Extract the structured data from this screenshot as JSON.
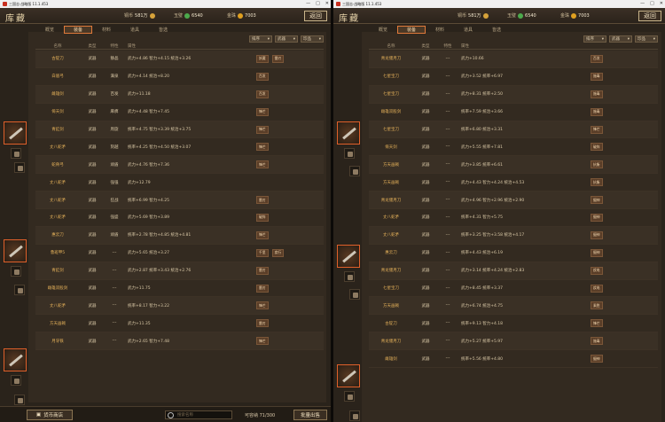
{
  "left": {
    "window_title": "三国志·战略版 11.1.453",
    "header_title": "库藏",
    "resources": [
      {
        "label": "铜币",
        "value": "581万",
        "color": "#d6a23a"
      },
      {
        "label": "玉璧",
        "value": "6540",
        "color": "#4caa4c"
      },
      {
        "label": "金珠",
        "value": "7003",
        "color": "#e0a020"
      }
    ],
    "back_label": "返回",
    "tabs": [
      "概览",
      "装备",
      "材料",
      "道具",
      "皆选"
    ],
    "active_tab": 1,
    "filters": [
      "排序",
      "武器",
      "珍品"
    ],
    "columns": [
      "名称",
      "类型",
      "特性",
      "属性"
    ],
    "rows": [
      {
        "name": "古锭刀",
        "type": "武器",
        "trait": "静晶",
        "stat": "武力+4.86 智力+4.15 统治+3.26",
        "tags": [
          "妖魔",
          "雷刃"
        ]
      },
      {
        "name": "白眉弓",
        "type": "武器",
        "trait": "满泉",
        "stat": "武力+4.14 统治+8.20",
        "tags": [
          "百发"
        ]
      },
      {
        "name": "雌雄剑",
        "type": "武器",
        "trait": "百发",
        "stat": "武力+11.18",
        "tags": [
          "百发"
        ]
      },
      {
        "name": "倚天剑",
        "type": "武器",
        "trait": "麻痹",
        "stat": "武力+4.48 智力+7.45",
        "tags": [
          "锋芒"
        ]
      },
      {
        "name": "青釭剑",
        "type": "武器",
        "trait": "周旋",
        "stat": "统率+4.75 智力+3.39 统治+3.75",
        "tags": [
          "锋芒"
        ]
      },
      {
        "name": "丈八蛇矛",
        "type": "武器",
        "trait": "刻越",
        "stat": "统率+4.25 智力+4.50 统治+3.07",
        "tags": [
          "锋芒"
        ]
      },
      {
        "name": "蛇骨弓",
        "type": "武器",
        "trait": "顽盾",
        "stat": "武力+4.76 智力+7.36",
        "tags": [
          "锋芒"
        ]
      },
      {
        "name": "丈八蛇矛",
        "type": "武器",
        "trait": "强强",
        "stat": "武力+12.79",
        "tags": []
      },
      {
        "name": "丈八蛇矛",
        "type": "武器",
        "trait": "狂战",
        "stat": "统率+6.99 智力+4.25",
        "tags": [
          "雷刃"
        ]
      },
      {
        "name": "丈八蛇矛",
        "type": "武器",
        "trait": "强盛",
        "stat": "武力+5.69 智力+3.89",
        "tags": [
          "破阵"
        ]
      },
      {
        "name": "惠云刀",
        "type": "武器",
        "trait": "顽盾",
        "stat": "统率+2.78 智力+4.85 统治+4.81",
        "tags": [
          "锋芒"
        ]
      },
      {
        "name": "鲁班甲5",
        "type": "武器",
        "trait": "---",
        "stat": "武力+5.65 统治+3.27",
        "tags": [
          "千里",
          "疾行"
        ]
      },
      {
        "name": "青釭剑",
        "type": "武器",
        "trait": "---",
        "stat": "武力+2.87 统率+3.43 统治+2.76",
        "tags": [
          "雷刃"
        ]
      },
      {
        "name": "雌雄双股剑",
        "type": "武器",
        "trait": "---",
        "stat": "武力+11.75",
        "tags": [
          "雷刃"
        ]
      },
      {
        "name": "丈八蛇矛",
        "type": "武器",
        "trait": "---",
        "stat": "统率+8.17 智力+3.22",
        "tags": [
          "锋芒"
        ]
      },
      {
        "name": "方天画戟",
        "type": "武器",
        "trait": "---",
        "stat": "武力+11.35",
        "tags": [
          "雷刃"
        ]
      },
      {
        "name": "月牙铁",
        "type": "武器",
        "trait": "---",
        "stat": "武力+2.65 智力+7.48",
        "tags": [
          "锋芒"
        ]
      }
    ],
    "shop_label": "货币商店",
    "search_placeholder": "搜索名称",
    "capacity": "可容纳 71/300",
    "sell_label": "批量出售"
  },
  "right": {
    "window_title": "三国志·战略版 11.1.453",
    "header_title": "库藏",
    "resources": [
      {
        "label": "铜币",
        "value": "581万",
        "color": "#d6a23a"
      },
      {
        "label": "玉璧",
        "value": "6540",
        "color": "#4caa4c"
      },
      {
        "label": "金珠",
        "value": "7003",
        "color": "#e0a020"
      }
    ],
    "back_label": "返回",
    "tabs": [
      "概览",
      "装备",
      "材料",
      "道具",
      "皆选"
    ],
    "active_tab": 1,
    "filters": [
      "排序",
      "武器",
      "珍品"
    ],
    "columns": [
      "名称",
      "类型",
      "特性",
      "属性"
    ],
    "rows": [
      {
        "name": "青龙偃月刀",
        "type": "武器",
        "trait": "---",
        "stat": "武力+10.66",
        "tags": [
          "百发"
        ]
      },
      {
        "name": "七星宝刀",
        "type": "武器",
        "trait": "---",
        "stat": "武力+3.52 统率+6.97",
        "tags": [
          "施毒"
        ]
      },
      {
        "name": "七星宝刀",
        "type": "武器",
        "trait": "---",
        "stat": "武力+8.31 统率+2.50",
        "tags": [
          "施毒"
        ]
      },
      {
        "name": "雌雄双股剑",
        "type": "武器",
        "trait": "---",
        "stat": "统率+7.59 统治+3.66",
        "tags": [
          "施毒"
        ]
      },
      {
        "name": "七星宝刀",
        "type": "武器",
        "trait": "---",
        "stat": "统率+6.80 统治+3.31",
        "tags": [
          "锋芒"
        ]
      },
      {
        "name": "倚天剑",
        "type": "武器",
        "trait": "---",
        "stat": "武力+5.55 统率+7.81",
        "tags": [
          "破阵"
        ]
      },
      {
        "name": "方天画戟",
        "type": "武器",
        "trait": "---",
        "stat": "武力+3.85 统率+6.61",
        "tags": [
          "抗衡"
        ]
      },
      {
        "name": "方天画戟",
        "type": "武器",
        "trait": "---",
        "stat": "武力+4.43 智力+4.24 统治+4.53",
        "tags": [
          "抗衡"
        ]
      },
      {
        "name": "青龙偃月刀",
        "type": "武器",
        "trait": "---",
        "stat": "武力+4.96 智力+2.96 统治+2.90",
        "tags": [
          "摄神"
        ]
      },
      {
        "name": "丈八蛇矛",
        "type": "武器",
        "trait": "---",
        "stat": "统率+4.31 智力+5.75",
        "tags": [
          "摄神"
        ]
      },
      {
        "name": "丈八蛇矛",
        "type": "武器",
        "trait": "---",
        "stat": "统率+3.25 智力+3.58 统治+4.17",
        "tags": [
          "摄神"
        ]
      },
      {
        "name": "惠云刀",
        "type": "武器",
        "trait": "---",
        "stat": "统率+4.43 统治+6.19",
        "tags": [
          "摄神"
        ]
      },
      {
        "name": "青龙偃月刀",
        "type": "武器",
        "trait": "---",
        "stat": "武力+3.14 统率+4.24 统治+2.83",
        "tags": [
          "疾电"
        ]
      },
      {
        "name": "七星宝刀",
        "type": "武器",
        "trait": "---",
        "stat": "武力+8.45 统率+3.37",
        "tags": [
          "疾电"
        ]
      },
      {
        "name": "方天画戟",
        "type": "武器",
        "trait": "---",
        "stat": "武力+6.74 统治+4.75",
        "tags": [
          "乘胜"
        ]
      },
      {
        "name": "古锭刀",
        "type": "武器",
        "trait": "---",
        "stat": "统率+9.13 智力+4.18",
        "tags": [
          "锋芒"
        ]
      },
      {
        "name": "青龙偃月刀",
        "type": "武器",
        "trait": "---",
        "stat": "武力+5.27 统率+5.97",
        "tags": [
          "施毒"
        ]
      },
      {
        "name": "雌雄剑",
        "type": "武器",
        "trait": "---",
        "stat": "统率+5.56 统率+4.80",
        "tags": [
          "摄神"
        ]
      }
    ]
  }
}
